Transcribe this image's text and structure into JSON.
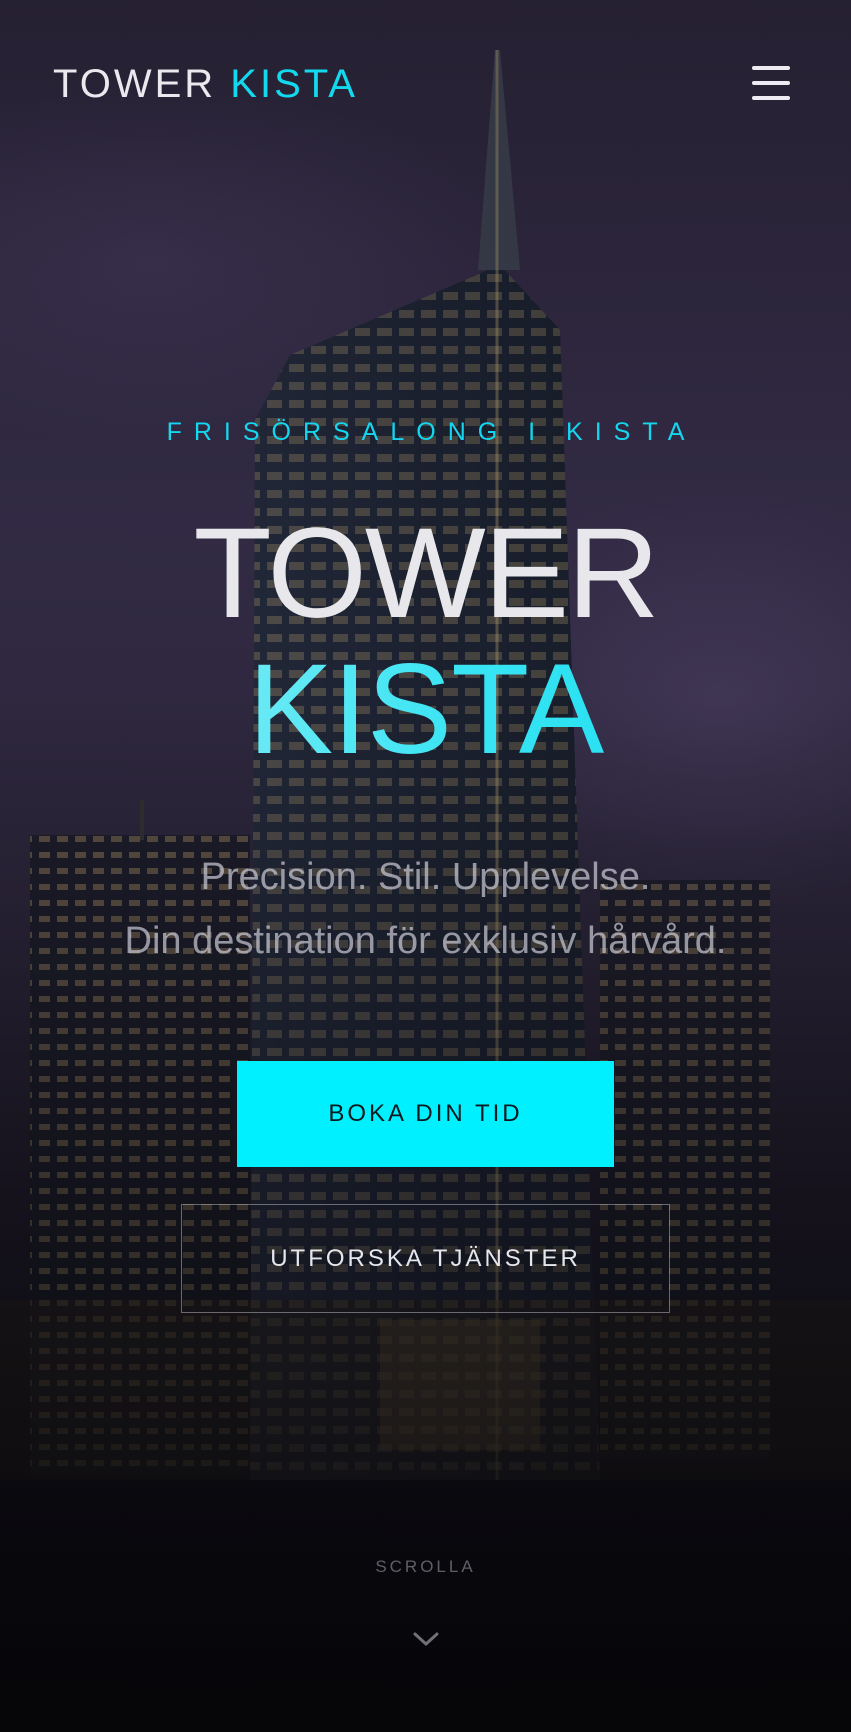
{
  "header": {
    "logo_main": "TOWER",
    "logo_accent": "KISTA",
    "menu_icon": "hamburger-menu-icon"
  },
  "hero": {
    "eyebrow": "FRISÖRSALONG I KISTA",
    "title_line1": "TOWER",
    "title_line2": "KISTA",
    "tagline_line1": "Precision. Stil. Upplevelse.",
    "tagline_line2": "Din destination för exklusiv hårvård."
  },
  "actions": {
    "primary_label": "BOKA DIN TID",
    "secondary_label": "UTFORSKA TJÄNSTER"
  },
  "scroll": {
    "label": "SCROLLA",
    "icon": "chevron-down-icon"
  },
  "colors": {
    "accent": "#00f0ff",
    "accent_text": "#13d9ee",
    "background": "#2a2438"
  }
}
